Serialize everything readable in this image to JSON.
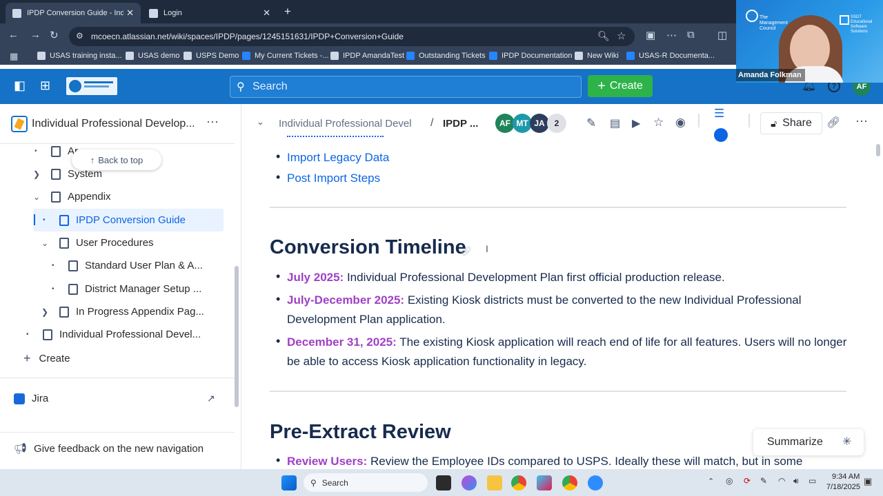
{
  "browser": {
    "tabs": [
      {
        "title": "IPDP Conversion Guide - Indivic",
        "active": true
      },
      {
        "title": "Login",
        "active": false
      }
    ],
    "url": "mcoecn.atlassian.net/wiki/spaces/IPDP/pages/1245151631/IPDP+Conversion+Guide",
    "bookmarks": [
      "USAS training insta...",
      "USAS demo",
      "USPS Demo",
      "My Current Tickets -...",
      "IPDP AmandaTest",
      "Outstanding Tickets",
      "IPDP Documentation",
      "New Wiki",
      "USAS-R Documenta..."
    ]
  },
  "video": {
    "participant_name": "Amanda Folkman",
    "logo_left": "The Management Council",
    "logo_right": "SSDT Educational Software Solutions"
  },
  "confluence_header": {
    "search_placeholder": "Search",
    "create_label": "Create",
    "user_initials": "AF",
    "brand_alt": "SSDT Educational Software Solutions"
  },
  "sidebar": {
    "space_title": "Individual Professional Develop...",
    "back_to_top": "Back to top",
    "items": [
      {
        "label": "Ar...",
        "level": 1
      },
      {
        "label": "System",
        "level": 1
      },
      {
        "label": "Appendix",
        "level": 1
      },
      {
        "label": "IPDP Conversion Guide",
        "level": 2
      },
      {
        "label": "User Procedures",
        "level": 2
      },
      {
        "label": "Standard User Plan & A...",
        "level": 3
      },
      {
        "label": "District Manager Setup ...",
        "level": 3
      },
      {
        "label": "In Progress Appendix Pag...",
        "level": 2
      },
      {
        "label": "Individual Professional Devel...",
        "level": 1
      }
    ],
    "create_label": "Create",
    "jira_label": "Jira",
    "feedback_label": "Give feedback on the new navigation"
  },
  "page": {
    "breadcrumb_parent": "Individual Professional Devel",
    "breadcrumb_current": "IPDP ...",
    "collaborators": [
      {
        "initials": "AF",
        "color": "#1f845a"
      },
      {
        "initials": "MT",
        "color": "#1d9aaa"
      },
      {
        "initials": "JA",
        "color": "#2c3e5d"
      }
    ],
    "collaborator_overflow": "2",
    "share_label": "Share",
    "links": [
      "Import Legacy Data",
      "Post Import Steps"
    ],
    "section1_title": "Conversion Timeline",
    "timeline": [
      {
        "date": "July 2025:",
        "text": " Individual Professional Development Plan first official production release."
      },
      {
        "date": "July-December 2025:",
        "text": " Existing Kiosk districts must be converted to the new Individual Professional Development Plan application."
      },
      {
        "date": "December 31, 2025:",
        "text": " The existing Kiosk application will reach end of life for all features.  Users will no longer be able to access Kiosk application functionality in legacy."
      }
    ],
    "section2_title": "Pre-Extract Review",
    "review_item": {
      "date": "Review Users:",
      "text": " Review the Employee IDs compared to USPS. Ideally these will match, but in some"
    },
    "summarize_label": "Summarize"
  },
  "taskbar": {
    "search_label": "Search",
    "time": "9:34 AM",
    "date": "7/18/2025"
  }
}
